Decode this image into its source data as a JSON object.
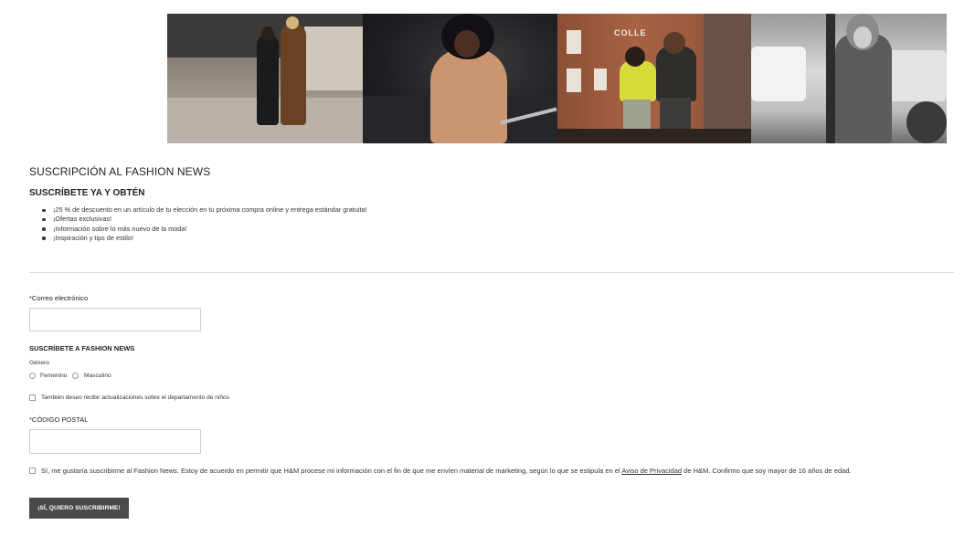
{
  "page": {
    "title": "SUSCRIPCIÓN AL FASHION NEWS",
    "subtitle": "SUSCRÍBETE YA Y OBTÉN",
    "benefits": [
      "¡25 % de descuento en un artículo de tu elección en tu próxima compra online y entrega estándar gratuita!",
      "¡Ofertas exclusivas!",
      "¡Información sobre lo más nuevo de la moda!",
      "¡Inspiración y tips de estilo!"
    ]
  },
  "form": {
    "email_label": "*Correo electrónico",
    "email_value": "",
    "email_placeholder": "",
    "subscribe_heading": "SUSCRÍBETE A FASHION NEWS",
    "gender_label": "Género",
    "gender_options": [
      "Femenino",
      "Masculino"
    ],
    "kids_checkbox_label": "También deseo recibir actualizaciones sobre el departamento de niños",
    "postal_label": "*CÓDIGO POSTAL",
    "postal_value": "",
    "postal_placeholder": "",
    "consent_text_before": "Sí, me gustaría suscribirme al Fashion News. Estoy de acuerdo en permitir que H&M procese mi información con el fin de que me envíen material de marketing, según lo que se estipula en el ",
    "consent_link": "Aviso de Privacidad",
    "consent_text_after": " de H&M. Confirmo que soy mayor de 16 años de edad.",
    "submit_label": "¡SÍ, QUIERO SUSCRIBIRME!"
  },
  "colors": {
    "button_bg": "#4a4a4a",
    "divider": "#d9d9d9",
    "input_border": "#cccccc"
  }
}
